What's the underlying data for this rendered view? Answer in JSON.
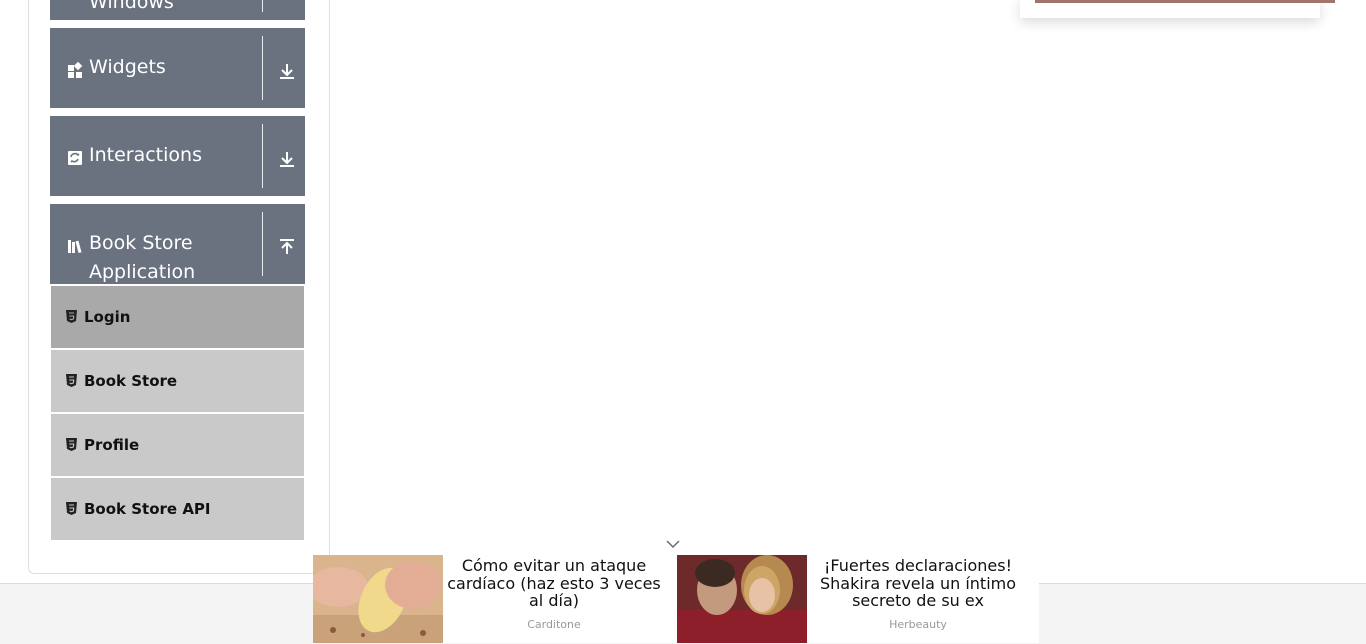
{
  "sidebar": {
    "groups": [
      {
        "label": "Windows",
        "icon": "window-icon",
        "toggle": "chevron-down-icon"
      },
      {
        "label": "Widgets",
        "icon": "widgets-icon",
        "toggle": "download-arrow-icon"
      },
      {
        "label": "Interactions",
        "icon": "interactions-icon",
        "toggle": "download-arrow-icon"
      },
      {
        "label": "Book Store Application",
        "icon": "book-icon",
        "toggle": "upload-arrow-icon"
      }
    ],
    "book_store_items": [
      {
        "label": "Login",
        "active": true
      },
      {
        "label": "Book Store",
        "active": false
      },
      {
        "label": "Profile",
        "active": false
      },
      {
        "label": "Book Store API",
        "active": false
      }
    ]
  },
  "ads": {
    "items": [
      {
        "title": "Cómo evitar un ataque cardíaco (haz esto 3 veces al día)",
        "source": "Carditone"
      },
      {
        "title": "¡Fuertes declaraciones! Shakira revela un íntimo secreto de su ex",
        "source": "Herbeauty"
      }
    ]
  },
  "colors": {
    "group_header_bg": "#6a7280",
    "sub_item_bg": "#c9c9c9",
    "sub_item_active_bg": "#a9a9a9"
  }
}
